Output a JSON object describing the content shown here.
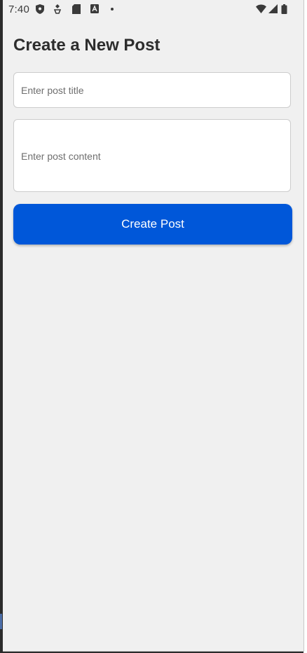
{
  "status_bar": {
    "time": "7:40",
    "left_icons": [
      "shield-icon",
      "location-icon",
      "sd-card-icon",
      "font-a-icon",
      "dot-icon"
    ],
    "right_icons": [
      "wifi-icon",
      "signal-icon",
      "battery-icon"
    ]
  },
  "page": {
    "title": "Create a New Post"
  },
  "form": {
    "title_placeholder": "Enter post title",
    "title_value": "",
    "content_placeholder": "Enter post content",
    "content_value": "",
    "submit_label": "Create Post"
  },
  "colors": {
    "background": "#f0f0f0",
    "button": "#0057d9",
    "title_text": "#2d2d2d"
  }
}
